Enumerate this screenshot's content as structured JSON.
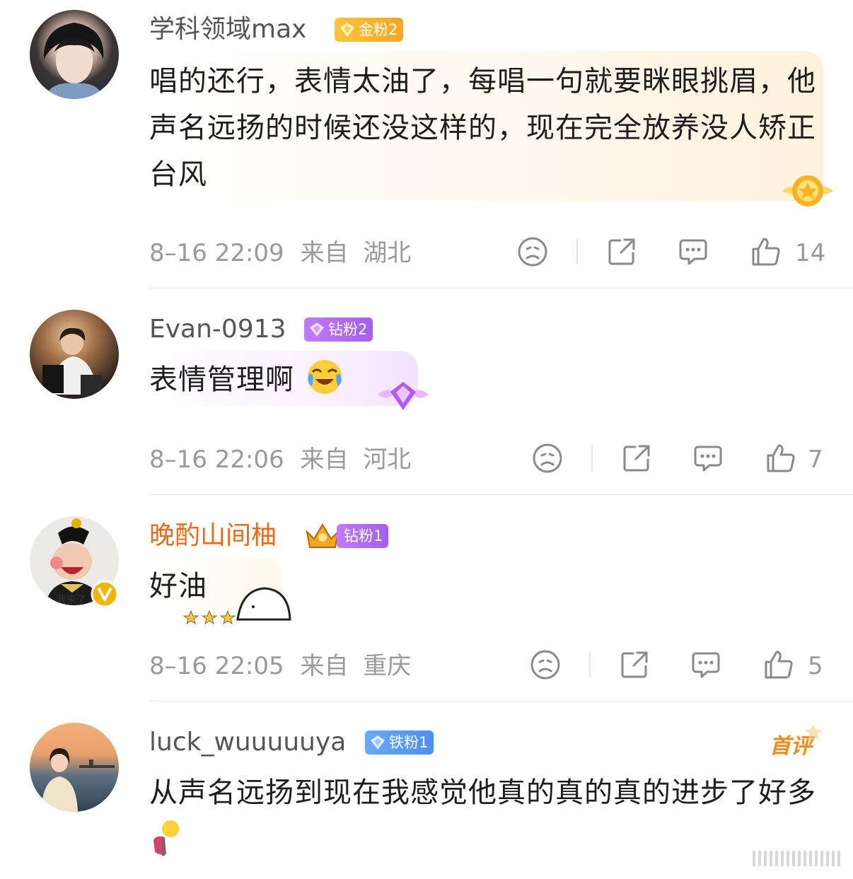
{
  "comments": [
    {
      "username": "学科领域max",
      "badge": {
        "label": "金粉2",
        "color": "#f5a623"
      },
      "text": "唱的还行，表情太油了，每唱一句就要眯眼挑眉，他声名远扬的时候还没这样的，现在完全放养没人矫正台风",
      "time": "8–16 22:09",
      "from": "来自",
      "location": "湖北",
      "likes": "14"
    },
    {
      "username": "Evan-0913",
      "badge": {
        "label": "钻粉2",
        "color": "#b66cf5"
      },
      "text": "表情管理啊",
      "time": "8–16 22:06",
      "from": "来自",
      "location": "河北",
      "likes": "7"
    },
    {
      "username": "晚酌山间柚",
      "badge": {
        "label": "钻粉1",
        "color": "#b66cf5"
      },
      "text": "好油",
      "avatar_caption": "我来了",
      "time": "8–16 22:05",
      "from": "来自",
      "location": "重庆",
      "likes": "5"
    },
    {
      "username": "luck_wuuuuuya",
      "badge": {
        "label": "铁粉1",
        "color": "#5c9cf0"
      },
      "first_tag": "首评",
      "text": "从声名远扬到现在我感觉他真的真的真的进步了好多"
    }
  ],
  "icons": [
    "sad-face-icon",
    "share-icon",
    "comment-icon",
    "like-icon",
    "laugh-cry-emoji",
    "verified-icon",
    "crown-icon"
  ]
}
